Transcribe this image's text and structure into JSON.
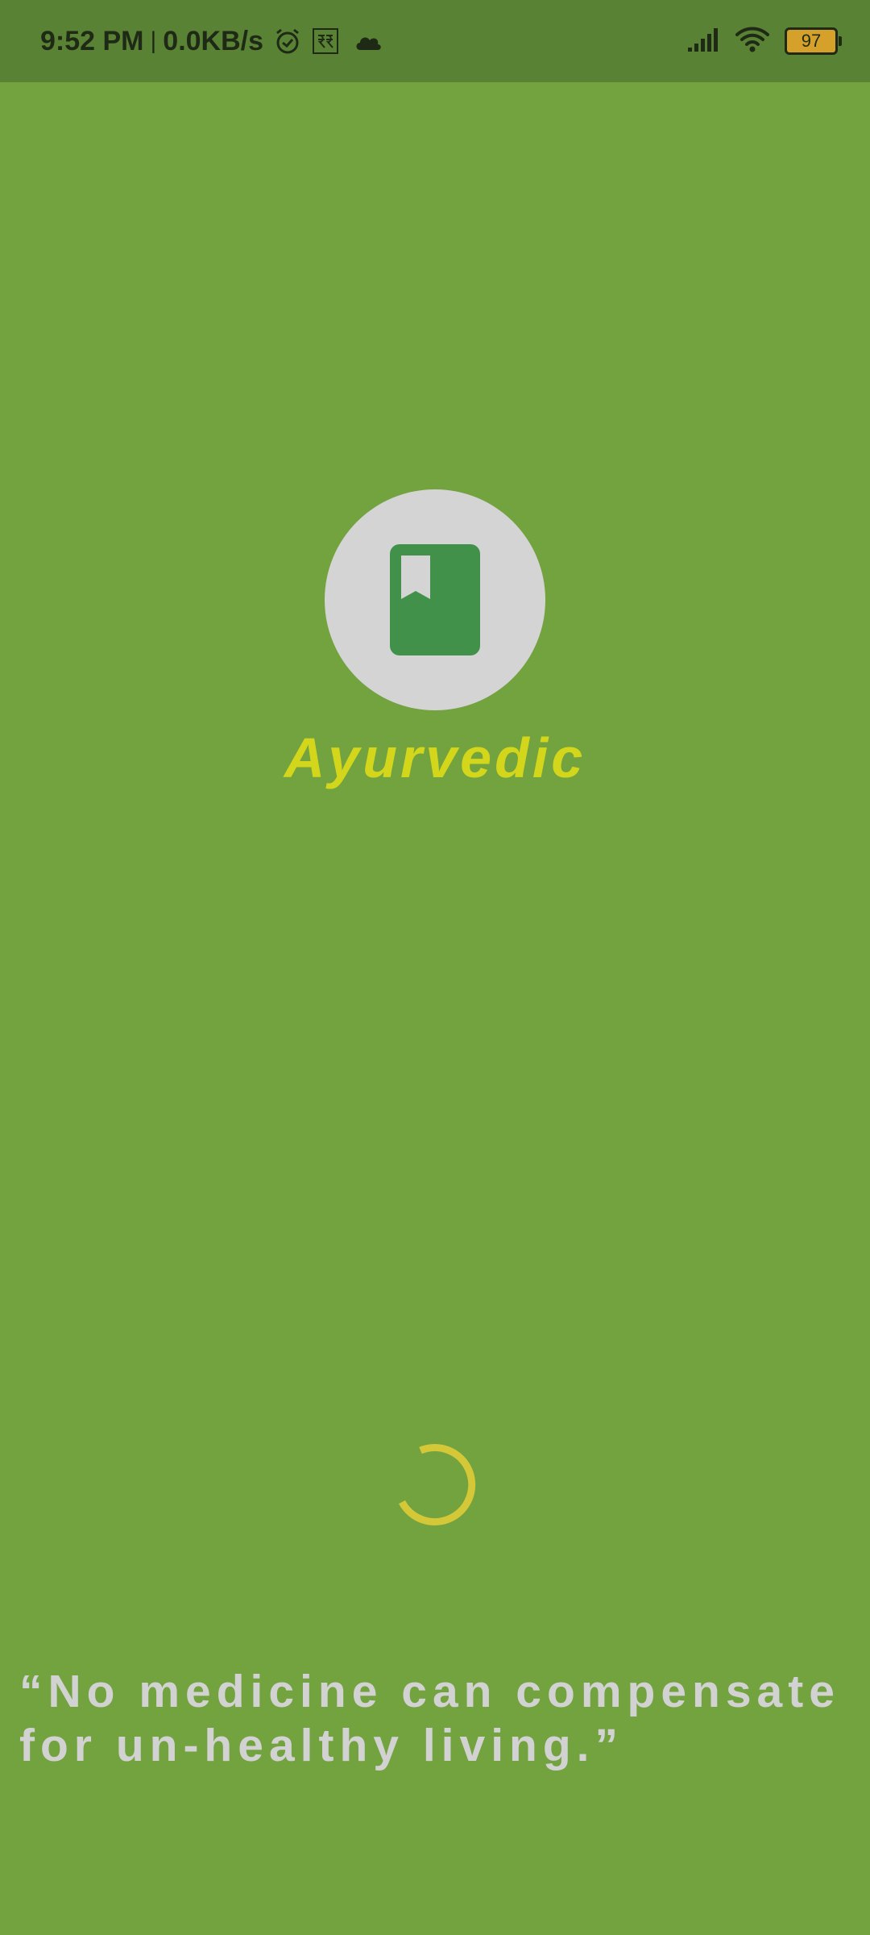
{
  "status_bar": {
    "time": "9:52 PM",
    "separator": "|",
    "network_speed": "0.0KB/s",
    "battery_level": "97",
    "icons": [
      "alarm-icon",
      "rupee-app-icon",
      "cloud-icon",
      "signal-icon",
      "wifi-icon",
      "battery-icon"
    ]
  },
  "splash": {
    "logo_icon": "bookmark-book-icon",
    "app_name": "Ayurvedic",
    "loading_indicator": "spinner-icon",
    "quote_line1": "“No medicine can compensate",
    "quote_line2": "for un-healthy living.”"
  },
  "colors": {
    "background": "#72a33f",
    "status_bar": "#5a8234",
    "logo_circle": "#d4d4d4",
    "book": "#41914a",
    "app_name": "#d3d61a",
    "spinner": "#d4c838",
    "quote": "#d2d2d2"
  }
}
